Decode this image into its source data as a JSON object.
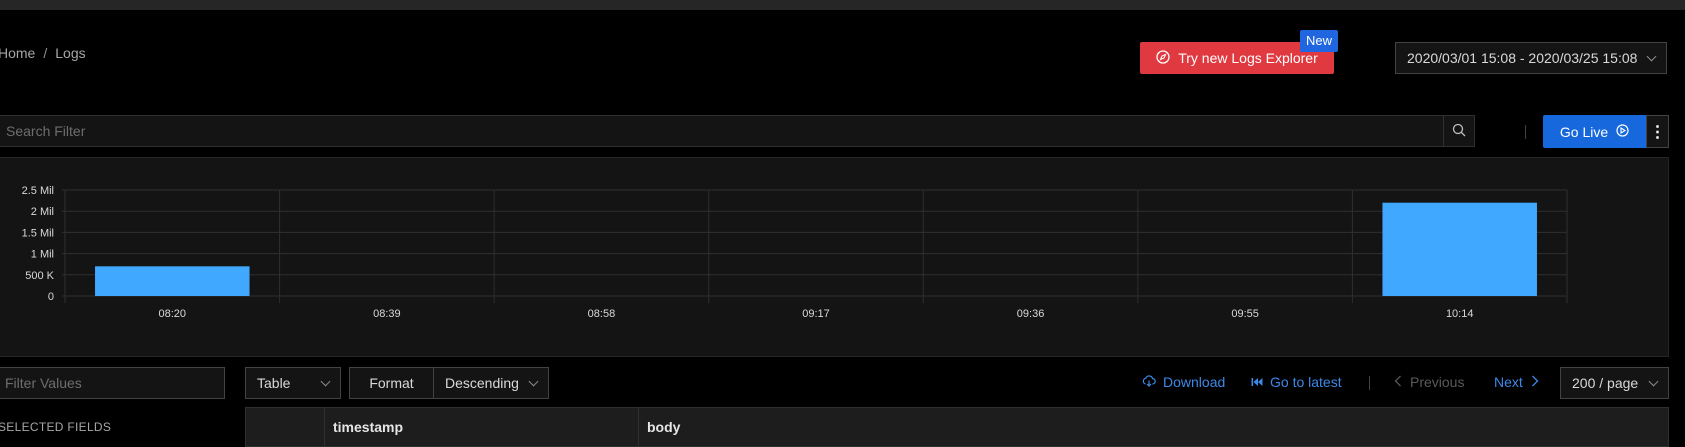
{
  "breadcrumb": {
    "home": "Home",
    "separator": "/",
    "current": "Logs"
  },
  "header": {
    "try_new_label": "Try new Logs Explorer",
    "new_badge": "New",
    "date_range": "2020/03/01 15:08 - 2020/03/25 15:08"
  },
  "search": {
    "placeholder": "Search Filter"
  },
  "live": {
    "go_live_label": "Go Live"
  },
  "chart_data": {
    "type": "bar",
    "categories": [
      "08:20",
      "08:39",
      "08:58",
      "09:17",
      "09:36",
      "09:55",
      "10:14"
    ],
    "values": [
      700000,
      0,
      0,
      0,
      0,
      0,
      2200000
    ],
    "y_ticks": [
      "0",
      "500 K",
      "1 Mil",
      "1.5 Mil",
      "2 Mil",
      "2.5 Mil"
    ],
    "ylim": [
      0,
      2500000
    ],
    "grid": true,
    "bar_color": "#40a9ff"
  },
  "sidebar": {
    "filter_placeholder": "Filter Values",
    "selected_fields_label": "SELECTED FIELDS"
  },
  "toolbar": {
    "view_mode": "Table",
    "format_label": "Format",
    "order": "Descending",
    "download_label": "Download",
    "go_to_latest_label": "Go to latest",
    "previous_label": "Previous",
    "next_label": "Next",
    "page_size": "200 / page"
  },
  "table": {
    "columns": [
      "",
      "timestamp",
      "body"
    ]
  },
  "colors": {
    "accent": "#1668dc",
    "danger": "#e0393f",
    "link": "#3c89e8"
  }
}
